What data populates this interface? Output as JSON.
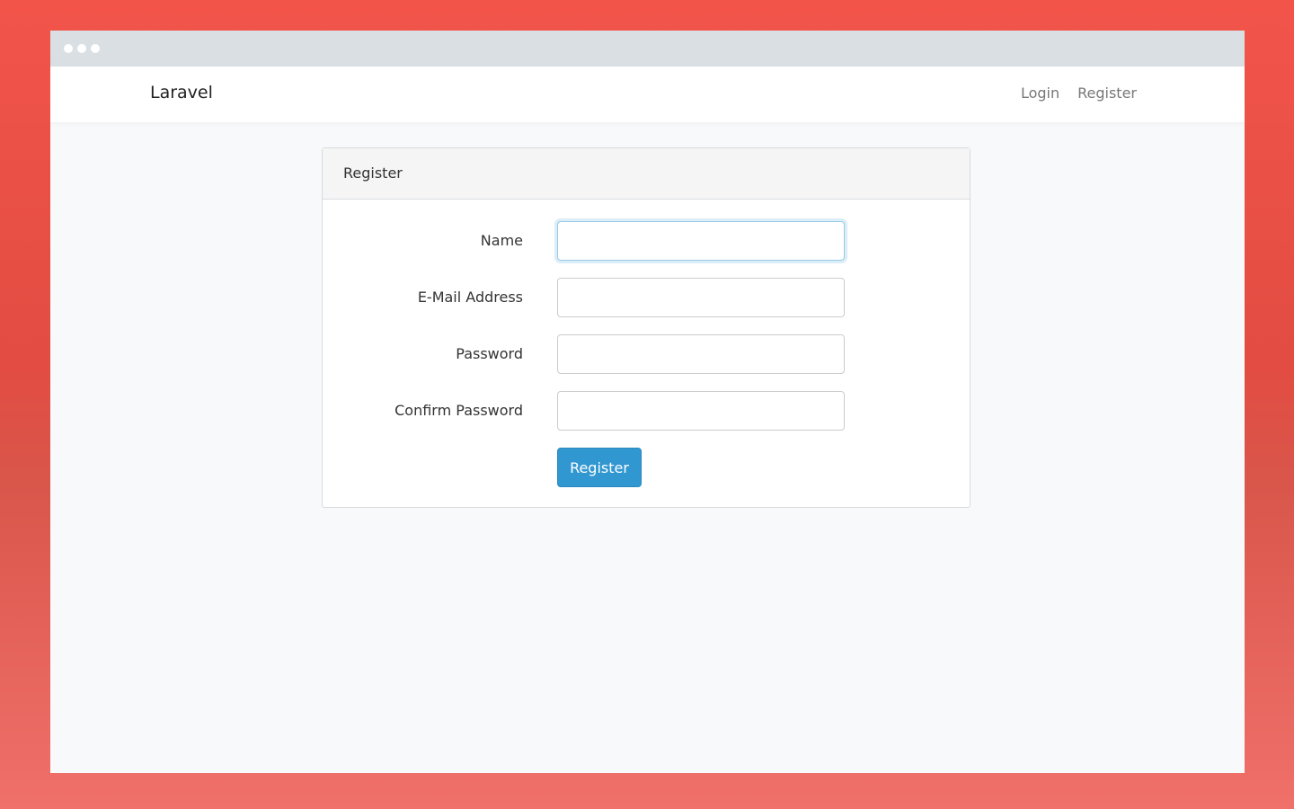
{
  "browser": {
    "window_dots": 3
  },
  "navbar": {
    "brand": "Laravel",
    "links": [
      {
        "label": "Login"
      },
      {
        "label": "Register"
      }
    ]
  },
  "register_card": {
    "header": "Register",
    "fields": [
      {
        "label": "Name",
        "value": "",
        "focused": true
      },
      {
        "label": "E-Mail Address",
        "value": ""
      },
      {
        "label": "Password",
        "value": ""
      },
      {
        "label": "Confirm Password",
        "value": ""
      }
    ],
    "submit_label": "Register"
  },
  "colors": {
    "background_gradient_top": "#f2544a",
    "background_gradient_bottom": "#f0706a",
    "titlebar": "#d9dfe2",
    "page_background": "#f7f9fb",
    "primary_button": "#3097d1",
    "focus_border": "#98cbe8"
  }
}
